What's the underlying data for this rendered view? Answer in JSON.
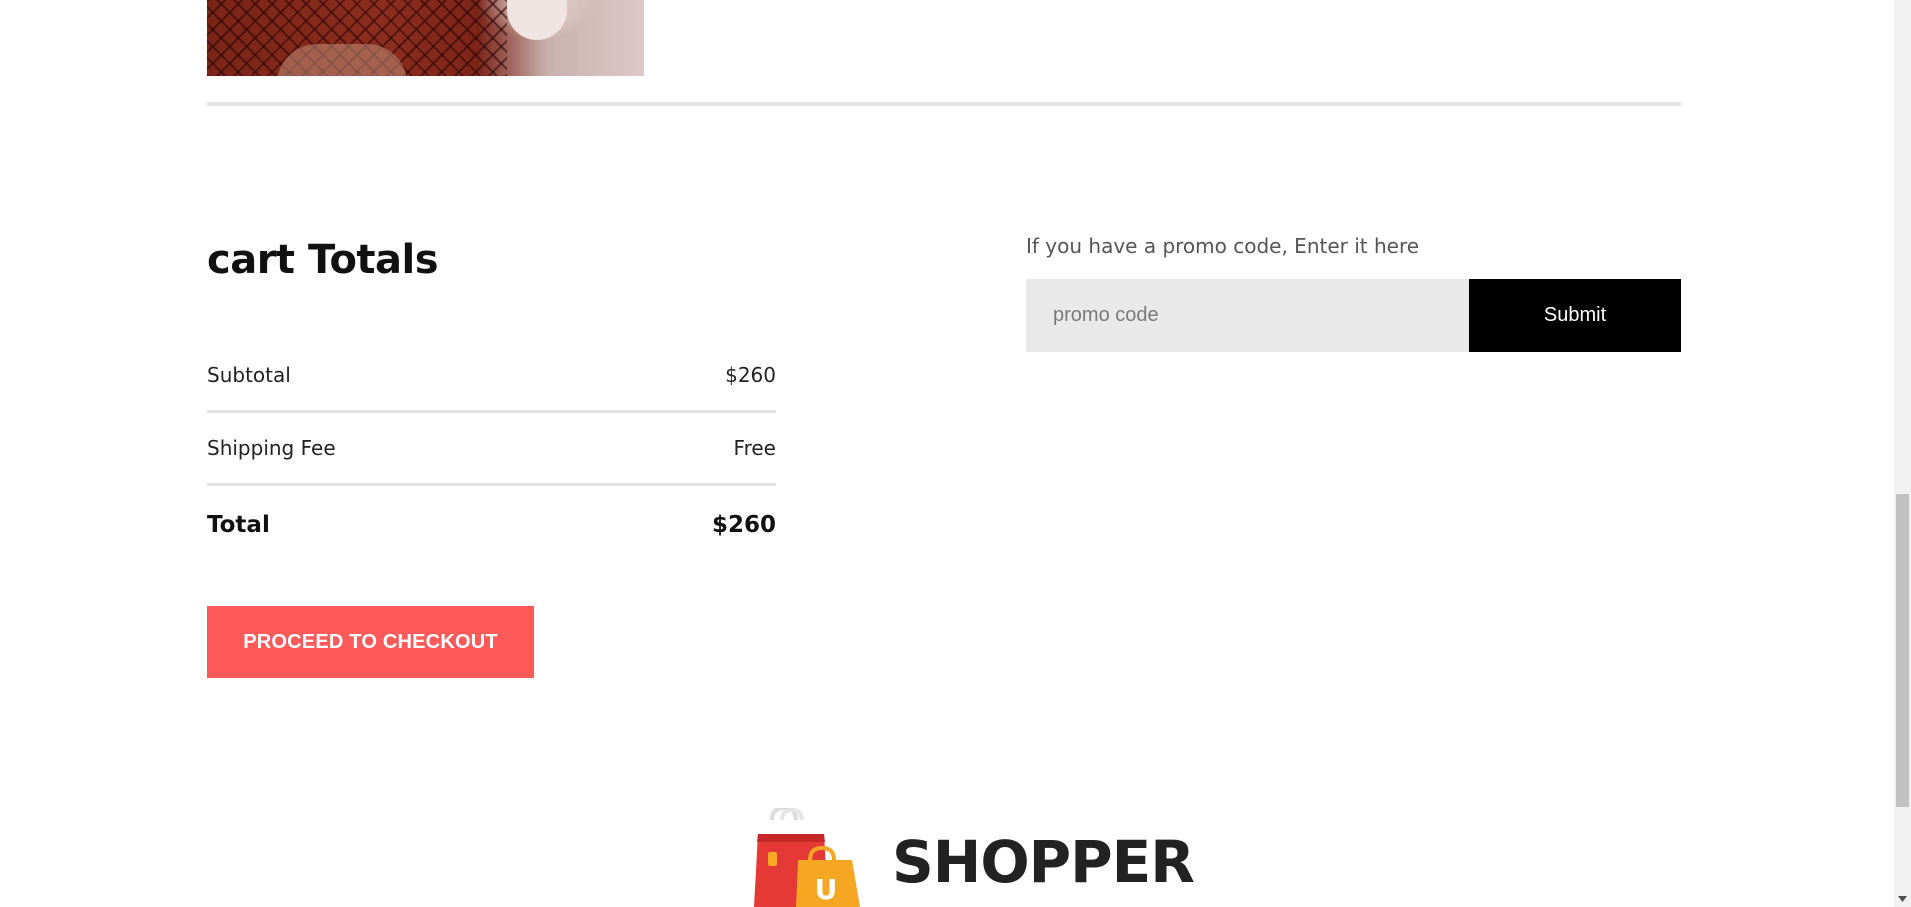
{
  "cart_totals": {
    "title": "cart Totals",
    "rows": [
      {
        "label": "Subtotal",
        "value": "$260"
      },
      {
        "label": "Shipping Fee",
        "value": "Free"
      }
    ],
    "total": {
      "label": "Total",
      "value": "$260"
    },
    "checkout_label": "PROCEED TO CHECKOUT"
  },
  "promo": {
    "label": "If you have a promo code, Enter it here",
    "placeholder": "promo code",
    "submit_label": "Submit"
  },
  "footer": {
    "brand": "SHOPPER",
    "bag_letter": "U"
  },
  "colors": {
    "checkout_button": "#ff5a5a",
    "submit_button": "#000000",
    "promo_input_bg": "#e9e9e9",
    "divider": "#e3e3e3"
  }
}
